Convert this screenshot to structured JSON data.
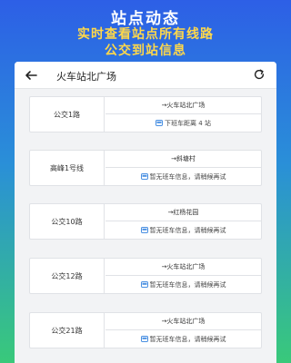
{
  "banner": {
    "title": "站点动态",
    "subtitle_line1": "实时查看站点所有线路",
    "subtitle_line2": "公交到站信息"
  },
  "appbar": {
    "title": "火车站北广场"
  },
  "routes": [
    {
      "name": "公交1路",
      "direction": "→火车站北广场",
      "status": "下班车距离 4 站"
    },
    {
      "name": "高峰1号线",
      "direction": "→斜塘村",
      "status": "暂无班车信息，请稍候再试"
    },
    {
      "name": "公交10路",
      "direction": "→红杨花园",
      "status": "暂无班车信息，请稍候再试"
    },
    {
      "name": "公交12路",
      "direction": "→火车站北广场",
      "status": "暂无班车信息，请稍候再试"
    },
    {
      "name": "公交21路",
      "direction": "→火车站北广场",
      "status": "暂无班车信息，请稍候再试"
    }
  ],
  "colors": {
    "gradient_top": "#2d5fe6",
    "gradient_bottom": "#39c97a",
    "subtitle": "#ffd84a",
    "bus_icon": "#4a90e2"
  },
  "icons": {
    "back": "arrow-left-icon",
    "refresh": "refresh-icon",
    "bus": "bus-icon"
  }
}
